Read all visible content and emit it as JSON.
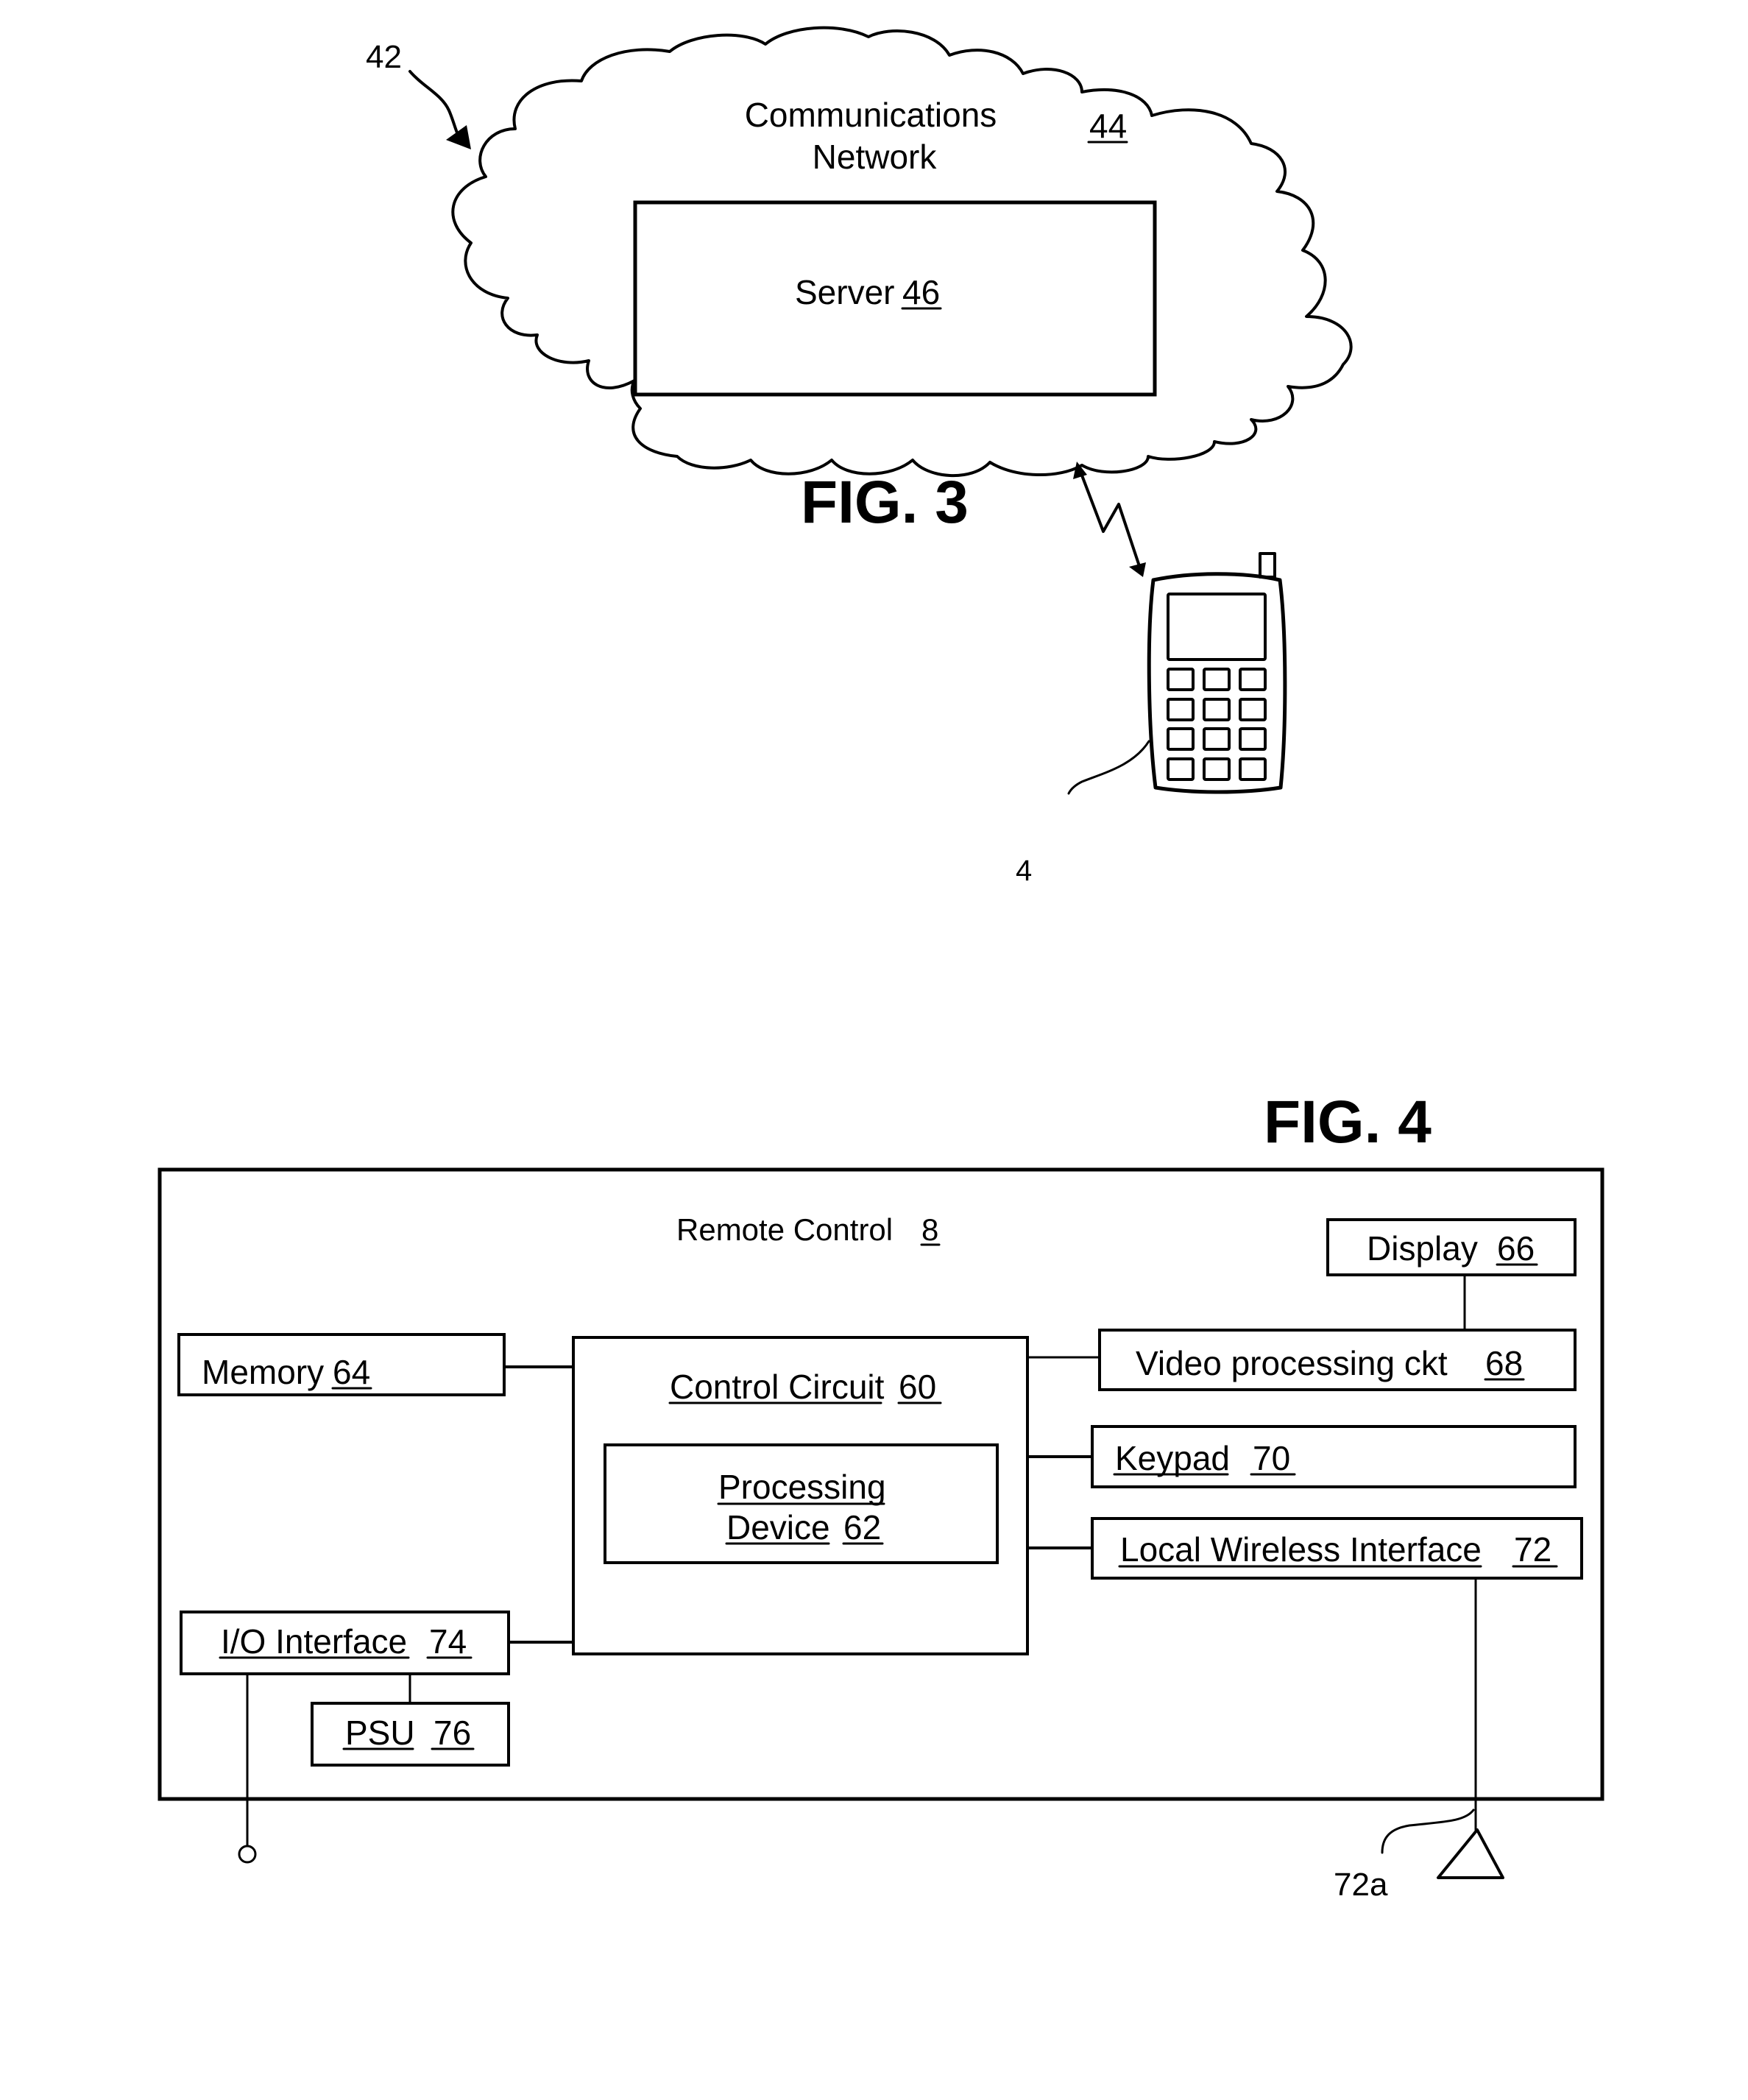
{
  "fig3": {
    "title": "FIG. 3",
    "system_ref": "42",
    "network": {
      "line1": "Communications",
      "line2": "Network",
      "ref": "44"
    },
    "server": {
      "label": "Server",
      "ref": "46"
    },
    "phone": {
      "ref": "4"
    }
  },
  "fig4": {
    "title": "FIG. 4",
    "device": {
      "label": "Remote Control",
      "ref": "8"
    },
    "blocks": {
      "memory": {
        "label": "Memory",
        "ref": "64"
      },
      "control_circuit": {
        "label": "Control Circuit",
        "ref": "60"
      },
      "processing_device": {
        "line1": "Processing",
        "line2": "Device",
        "ref": "62"
      },
      "display": {
        "label": "Display",
        "ref": "66"
      },
      "video": {
        "label": "Video processing ckt",
        "ref": "68"
      },
      "keypad": {
        "label": "Keypad",
        "ref": "70"
      },
      "wireless": {
        "label": "Local Wireless Interface",
        "ref": "72"
      },
      "io": {
        "label": "I/O Interface",
        "ref": "74"
      },
      "psu": {
        "label": "PSU",
        "ref": "76"
      }
    },
    "antenna_ref": "72a"
  }
}
